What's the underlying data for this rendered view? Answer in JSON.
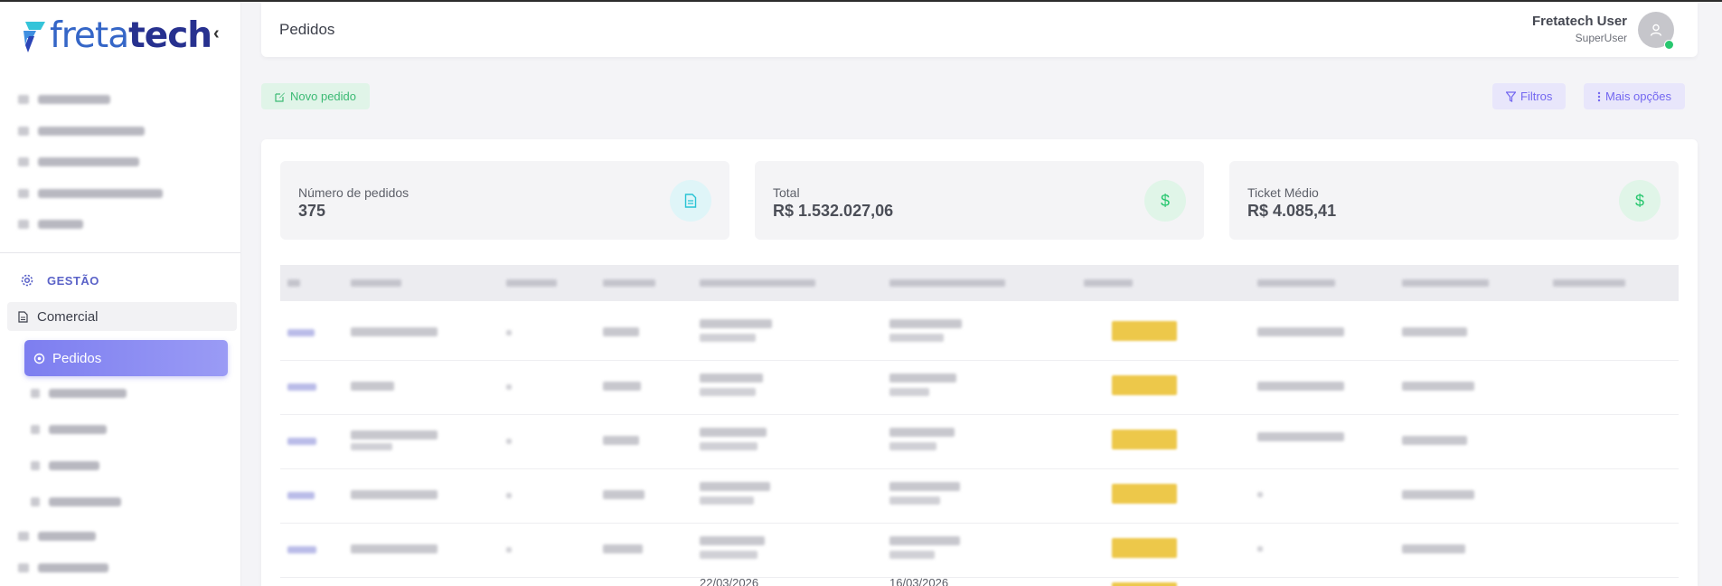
{
  "app": {
    "logo_text_light": "freta",
    "logo_text_bold": "tech",
    "collapse_glyph": "‹"
  },
  "sidebar": {
    "section_title": "GESTÃO",
    "comercial_label": "Comercial",
    "active_item_label": "Pedidos"
  },
  "header": {
    "page_title": "Pedidos",
    "user_name": "Fretatech User",
    "user_role": "SuperUser"
  },
  "actions": {
    "new_order": "Novo pedido",
    "filters": "Filtros",
    "more_options": "Mais opções"
  },
  "stats": [
    {
      "label": "Número de pedidos",
      "value": "375",
      "icon": "document-icon",
      "color": "#28c3d4"
    },
    {
      "label": "Total",
      "value": "R$ 1.532.027,06",
      "icon": "dollar-icon",
      "color": "#28c76f"
    },
    {
      "label": "Ticket Médio",
      "value": "R$ 4.085,41",
      "icon": "dollar-icon",
      "color": "#28c76f"
    }
  ],
  "table": {
    "visible_dates": [
      "22/03/2026",
      "16/03/2026"
    ]
  },
  "colors": {
    "accent": "#7367f0",
    "success": "#28c76f",
    "badge": "#edc84a"
  }
}
